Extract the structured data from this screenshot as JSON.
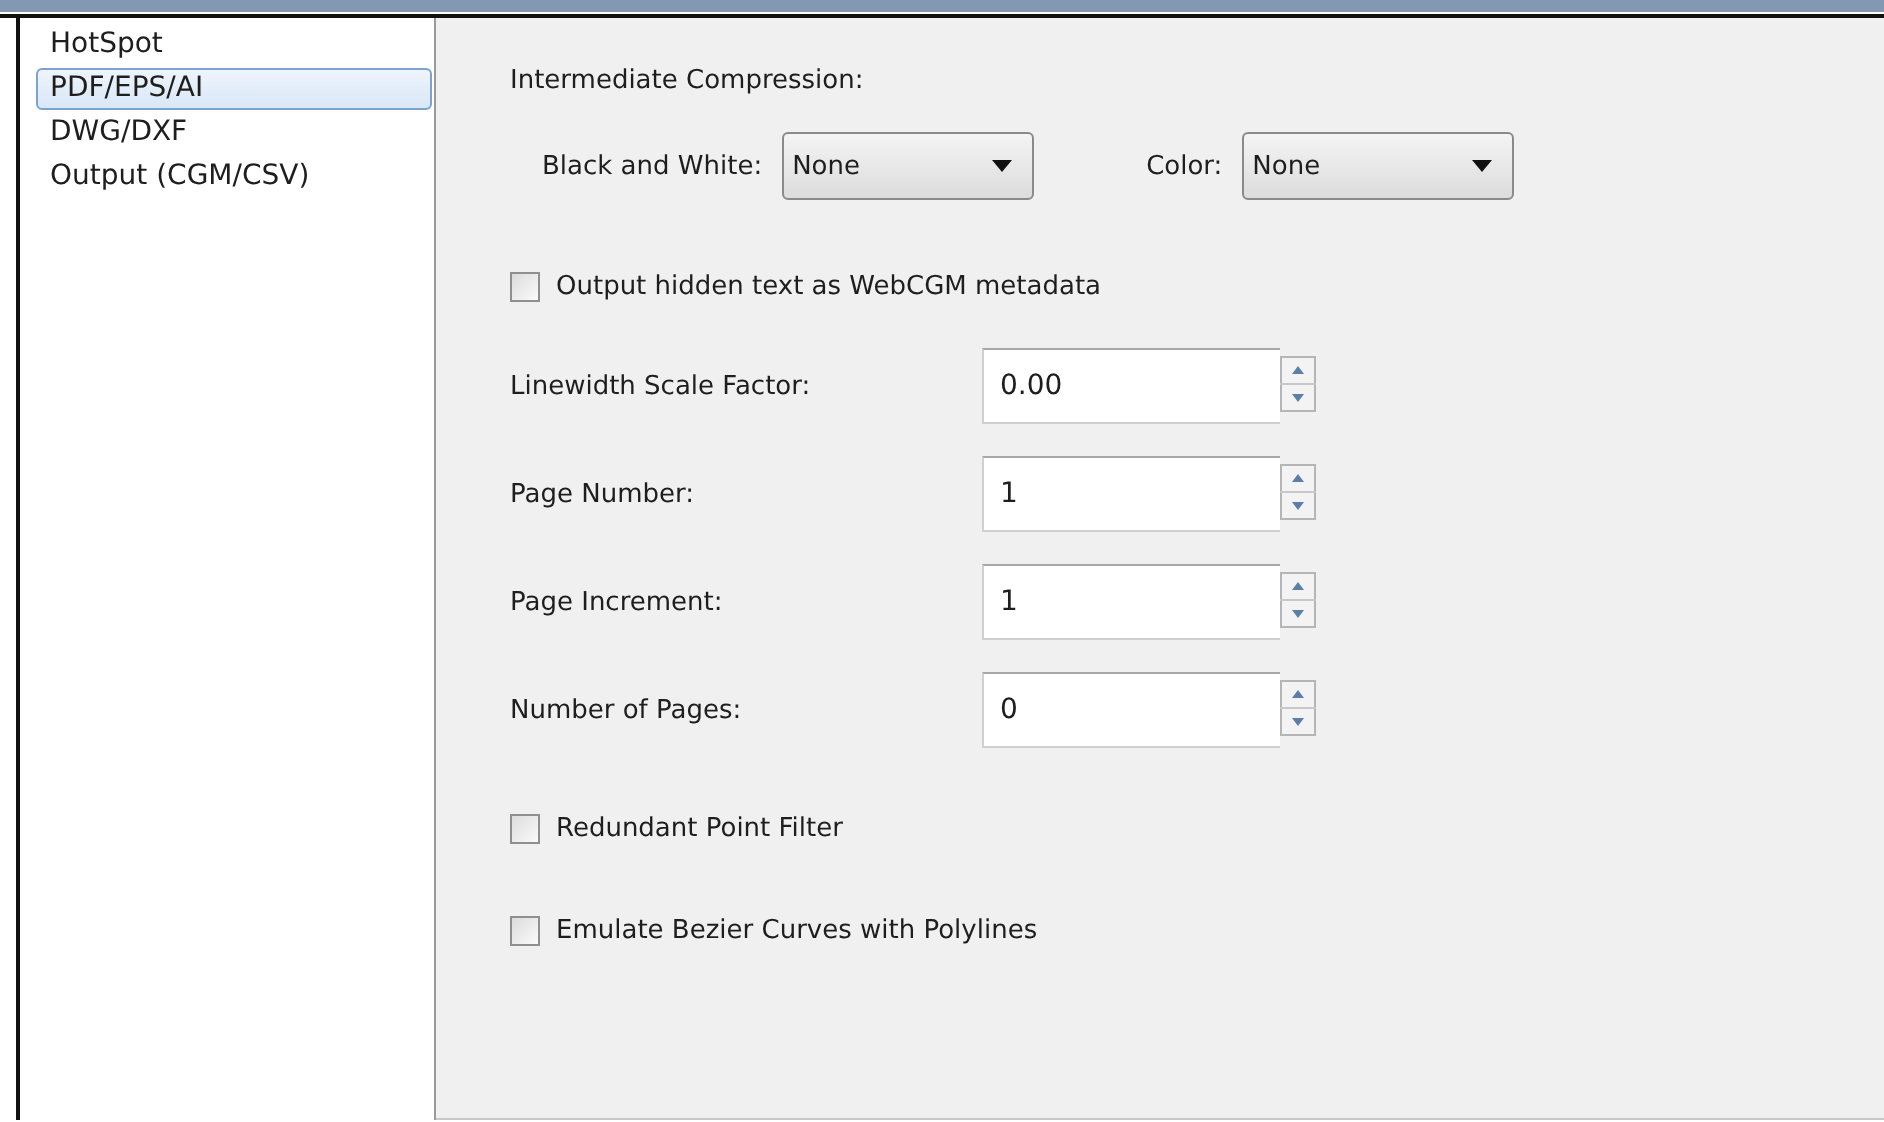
{
  "sidebar": {
    "items": [
      {
        "label": "HotSpot",
        "selected": false
      },
      {
        "label": "PDF/EPS/AI",
        "selected": true
      },
      {
        "label": "DWG/DXF",
        "selected": false
      },
      {
        "label": "Output (CGM/CSV)",
        "selected": false
      }
    ]
  },
  "compression": {
    "title": "Intermediate Compression:",
    "dropdowns": [
      {
        "label": "Black and White:",
        "value": "None"
      },
      {
        "label": "Color:",
        "value": "None"
      }
    ]
  },
  "hidden_text": {
    "label": "Output hidden text as WebCGM metadata",
    "checked": false
  },
  "spin_fields": [
    {
      "label": "Linewidth Scale Factor:",
      "value": "0.00"
    },
    {
      "label": "Page Number:",
      "value": "1"
    },
    {
      "label": "Page Increment:",
      "value": "1"
    },
    {
      "label": "Number of Pages:",
      "value": "0"
    }
  ],
  "options": [
    {
      "label": "Redundant Point Filter",
      "checked": false
    },
    {
      "label": "Emulate Bezier Curves with Polylines",
      "checked": false
    }
  ]
}
